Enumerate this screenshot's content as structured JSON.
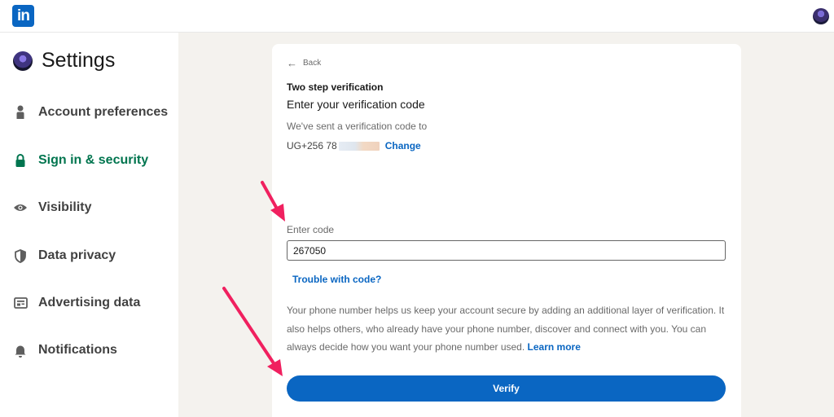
{
  "header": {
    "logo_text": "in"
  },
  "sidebar": {
    "title": "Settings",
    "items": [
      {
        "label": "Account preferences",
        "icon": "person-icon"
      },
      {
        "label": "Sign in & security",
        "icon": "lock-icon",
        "active": true
      },
      {
        "label": "Visibility",
        "icon": "eye-icon"
      },
      {
        "label": "Data privacy",
        "icon": "shield-icon"
      },
      {
        "label": "Advertising data",
        "icon": "ad-card-icon"
      },
      {
        "label": "Notifications",
        "icon": "bell-icon"
      }
    ]
  },
  "main": {
    "back_label": "Back",
    "step_label": "Two step verification",
    "heading": "Enter your verification code",
    "sent_text": "We've sent a verification code to",
    "phone_prefix": "UG+256 78",
    "change_label": "Change",
    "code_label": "Enter code",
    "code_value": "267050",
    "trouble_label": "Trouble with code?",
    "info_text": "Your phone number helps us keep your account secure by adding an additional layer of verification. It also helps others, who already have your phone number, discover and connect with you. You can always decide how you want your phone number used.",
    "learn_more_label": "Learn more",
    "verify_label": "Verify"
  },
  "colors": {
    "brand_blue": "#0a66c2",
    "active_green": "#01754f",
    "annotation_pink": "#f0205f",
    "page_bg": "#f4f2ee"
  }
}
